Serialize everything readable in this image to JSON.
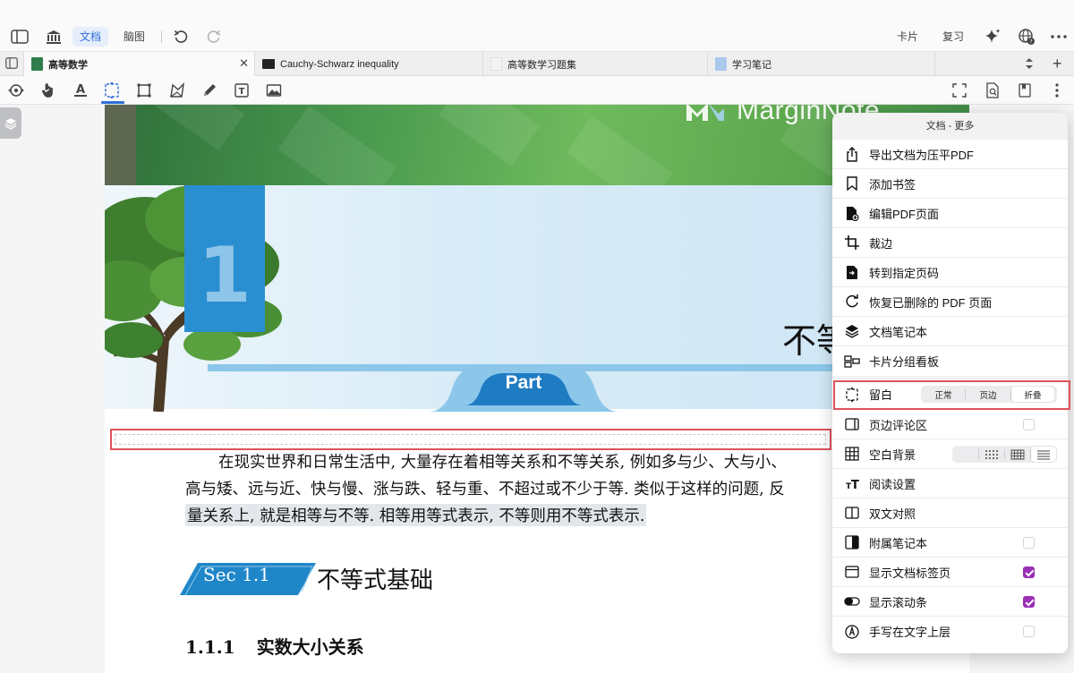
{
  "toolbar": {
    "doc_label": "文档",
    "mindmap_label": "脑图",
    "cards_label": "卡片",
    "review_label": "复习",
    "icons": [
      "sidebar-icon",
      "library-icon",
      "undo-icon",
      "redo-icon",
      "sparkle-icon",
      "www-icon",
      "more-icon"
    ]
  },
  "tabs": [
    {
      "label": "高等数学",
      "active": true,
      "icon_color": "#2f7d4c"
    },
    {
      "label": "Cauchy-Schwarz inequality",
      "active": false,
      "icon_color": "#222222"
    },
    {
      "label": "高等数学习题集",
      "active": false,
      "icon_color": "#f4f4f4"
    },
    {
      "label": "学习笔记",
      "active": false,
      "icon_color": "#a9c8ea"
    }
  ],
  "tools": [
    "lasso-icon",
    "hand-icon",
    "text-highlight-icon",
    "margin-select-icon",
    "rectangle-icon",
    "polygon-icon",
    "pen-icon",
    "textbox-icon",
    "image-icon"
  ],
  "document": {
    "logo": "MarginNote",
    "chapter_number": "1",
    "chapter_title": "不等",
    "part_label": "Part",
    "body_lines": [
      "在现实世界和日常生活中, 大量存在着相等关系和不等关系, 例如多与少、大与小、",
      "高与矮、远与近、快与慢、涨与跌、轻与重、不超过或不少于等. 类似于这样的问题, 反",
      "量关系上, 就是相等与不等. 相等用等式表示, 不等则用不等式表示."
    ],
    "section_label": "Sec 1.1",
    "section_title": "不等式基础",
    "subsection_number": "1.1.1",
    "subsection_title": "实数大小关系"
  },
  "popover": {
    "title": "文档 - 更多",
    "group1": [
      {
        "label": "导出文档为压平PDF",
        "icon": "share-icon"
      },
      {
        "label": "添加书签",
        "icon": "bookmark-icon"
      },
      {
        "label": "编辑PDF页面",
        "icon": "edit-pdf-icon"
      },
      {
        "label": "裁边",
        "icon": "crop-icon"
      },
      {
        "label": "转到指定页码",
        "icon": "goto-page-icon"
      },
      {
        "label": "恢复已删除的 PDF 页面",
        "icon": "restore-icon"
      },
      {
        "label": "文档笔记本",
        "icon": "layers-icon"
      },
      {
        "label": "卡片分组看板",
        "icon": "board-icon"
      }
    ],
    "margin_row": {
      "label": "留白",
      "options": [
        "正常",
        "页边",
        "折叠"
      ],
      "selected": 2
    },
    "group2": [
      {
        "label": "页边评论区",
        "icon": "sidebar-comment-icon",
        "checked": false
      },
      {
        "label": "空白背景",
        "icon": "grid-icon",
        "options": [
          "",
          "dots",
          "grid",
          "lines"
        ],
        "selected": 3
      },
      {
        "label": "阅读设置",
        "icon": "text-size-icon"
      },
      {
        "label": "双文对照",
        "icon": "dual-page-icon"
      },
      {
        "label": "附属笔记本",
        "icon": "half-square-icon",
        "checked": false
      },
      {
        "label": "显示文档标签页",
        "icon": "window-icon",
        "checked": true
      },
      {
        "label": "显示滚动条",
        "icon": "toggle-icon",
        "checked": true
      },
      {
        "label": "手写在文字上层",
        "icon": "pen-circle-icon",
        "checked": false
      }
    ]
  },
  "colors": {
    "accent": "#2f6ed8",
    "check": "#9b2fb6",
    "highlight": "#e0525b"
  }
}
